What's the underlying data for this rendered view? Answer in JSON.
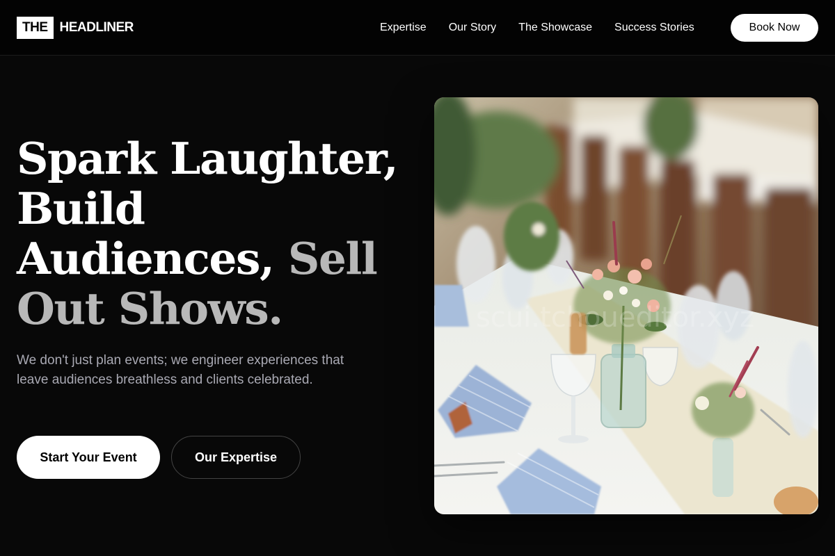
{
  "brand": {
    "logo_box": "THE",
    "logo_text": "HEADLINER"
  },
  "nav": {
    "items": [
      "Expertise",
      "Our Story",
      "The Showcase",
      "Success Stories"
    ],
    "book_label": "Book Now"
  },
  "hero": {
    "headline_lines": [
      {
        "text": "Spark Laughter,",
        "accent": ""
      },
      {
        "text": "Build",
        "accent": ""
      },
      {
        "text": "Audiences, ",
        "accent": "Sell"
      },
      {
        "text": "",
        "accent": "Out Shows."
      }
    ],
    "subtext": "We don't just plan events; we engineer experiences that leave audiences breathless and clients celebrated.",
    "primary_cta": "Start Your Event",
    "secondary_cta": "Our Expertise",
    "image_watermark": "scui.tchoueditor.xyz"
  },
  "colors": {
    "background": "#080808",
    "header_background": "#030303",
    "accent_text": "#b8b8b8",
    "subtext": "#a9a9b3"
  }
}
